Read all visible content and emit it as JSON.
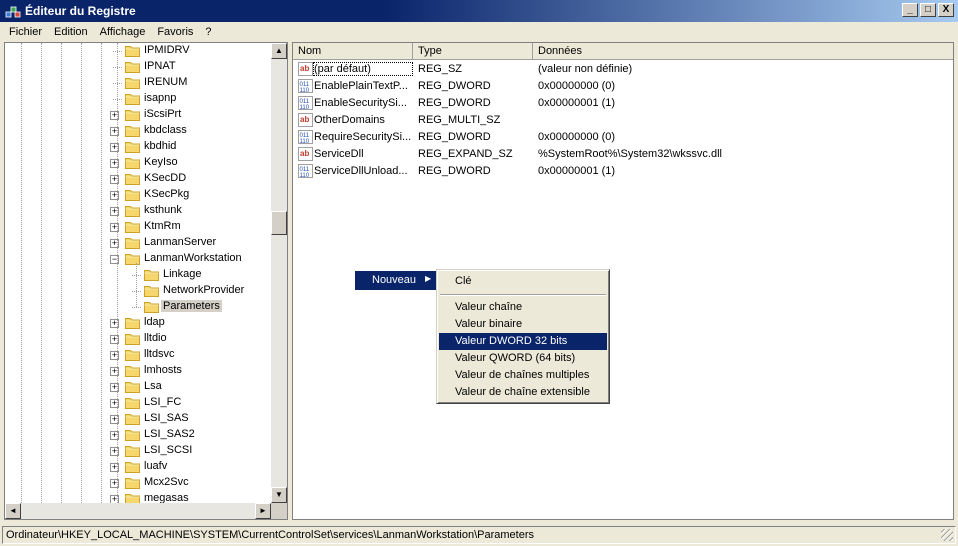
{
  "window": {
    "title": "Éditeur du Registre",
    "controls": [
      "_",
      "□",
      "X"
    ]
  },
  "menu": [
    "Fichier",
    "Edition",
    "Affichage",
    "Favoris",
    "?"
  ],
  "tree": {
    "items": [
      {
        "label": "IPMIDRV",
        "level": 1,
        "expander": ""
      },
      {
        "label": "IPNAT",
        "level": 1,
        "expander": ""
      },
      {
        "label": "IRENUM",
        "level": 1,
        "expander": ""
      },
      {
        "label": "isapnp",
        "level": 1,
        "expander": ""
      },
      {
        "label": "iScsiPrt",
        "level": 1,
        "expander": "+"
      },
      {
        "label": "kbdclass",
        "level": 1,
        "expander": "+"
      },
      {
        "label": "kbdhid",
        "level": 1,
        "expander": "+"
      },
      {
        "label": "KeyIso",
        "level": 1,
        "expander": "+"
      },
      {
        "label": "KSecDD",
        "level": 1,
        "expander": "+"
      },
      {
        "label": "KSecPkg",
        "level": 1,
        "expander": "+"
      },
      {
        "label": "ksthunk",
        "level": 1,
        "expander": "+"
      },
      {
        "label": "KtmRm",
        "level": 1,
        "expander": "+"
      },
      {
        "label": "LanmanServer",
        "level": 1,
        "expander": "+"
      },
      {
        "label": "LanmanWorkstation",
        "level": 1,
        "expander": "-"
      },
      {
        "label": "Linkage",
        "level": 2,
        "expander": ""
      },
      {
        "label": "NetworkProvider",
        "level": 2,
        "expander": ""
      },
      {
        "label": "Parameters",
        "level": 2,
        "expander": "",
        "selected": true
      },
      {
        "label": "ldap",
        "level": 1,
        "expander": "+"
      },
      {
        "label": "lltdio",
        "level": 1,
        "expander": "+"
      },
      {
        "label": "lltdsvc",
        "level": 1,
        "expander": "+"
      },
      {
        "label": "lmhosts",
        "level": 1,
        "expander": "+"
      },
      {
        "label": "Lsa",
        "level": 1,
        "expander": "+"
      },
      {
        "label": "LSI_FC",
        "level": 1,
        "expander": "+"
      },
      {
        "label": "LSI_SAS",
        "level": 1,
        "expander": "+"
      },
      {
        "label": "LSI_SAS2",
        "level": 1,
        "expander": "+"
      },
      {
        "label": "LSI_SCSI",
        "level": 1,
        "expander": "+"
      },
      {
        "label": "luafv",
        "level": 1,
        "expander": "+"
      },
      {
        "label": "Mcx2Svc",
        "level": 1,
        "expander": "+"
      },
      {
        "label": "megasas",
        "level": 1,
        "expander": "+"
      }
    ],
    "scroll": {
      "up": "▲",
      "down": "▼",
      "left": "◄",
      "right": "►"
    }
  },
  "list": {
    "columns": [
      "Nom",
      "Type",
      "Données"
    ],
    "rows": [
      {
        "icon": "ab",
        "name": "(par défaut)",
        "type": "REG_SZ",
        "data": "(valeur non définie)"
      },
      {
        "icon": "bin",
        "name": "EnablePlainTextP...",
        "type": "REG_DWORD",
        "data": "0x00000000 (0)"
      },
      {
        "icon": "bin",
        "name": "EnableSecuritySi...",
        "type": "REG_DWORD",
        "data": "0x00000001 (1)"
      },
      {
        "icon": "ab",
        "name": "OtherDomains",
        "type": "REG_MULTI_SZ",
        "data": ""
      },
      {
        "icon": "bin",
        "name": "RequireSecuritySi...",
        "type": "REG_DWORD",
        "data": "0x00000000 (0)"
      },
      {
        "icon": "ab",
        "name": "ServiceDll",
        "type": "REG_EXPAND_SZ",
        "data": "%SystemRoot%\\System32\\wkssvc.dll"
      },
      {
        "icon": "bin",
        "name": "ServiceDllUnload...",
        "type": "REG_DWORD",
        "data": "0x00000001 (1)"
      }
    ]
  },
  "context_menu": {
    "parent": "Nouveau",
    "items": [
      "Clé",
      "Valeur chaîne",
      "Valeur binaire",
      "Valeur DWORD 32 bits",
      "Valeur QWORD (64 bits)",
      "Valeur de chaînes multiples",
      "Valeur de chaîne extensible"
    ],
    "highlighted": "Valeur DWORD 32 bits"
  },
  "status": {
    "path": "Ordinateur\\HKEY_LOCAL_MACHINE\\SYSTEM\\CurrentControlSet\\services\\LanmanWorkstation\\Parameters"
  }
}
